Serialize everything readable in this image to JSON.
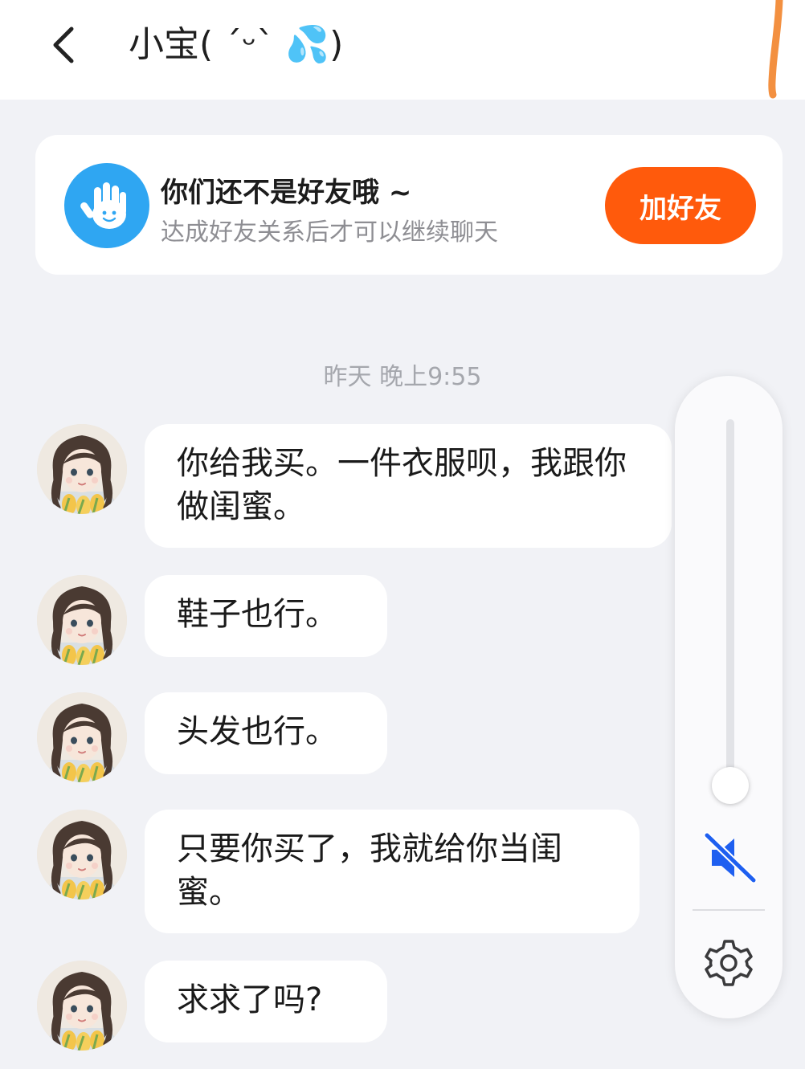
{
  "header": {
    "title": "小宝( ˊᵕˋ 💦)",
    "back_icon": "chevron-left-icon"
  },
  "friend_notice": {
    "title": "你们还不是好友哦 ~",
    "subtitle": "达成好友关系后才可以继续聊天",
    "button_label": "加好友",
    "icon": "hand-wave-icon",
    "accent_color": "#ff5a0c",
    "icon_color": "#2fa6f2"
  },
  "timestamp": "昨天 晚上9:55",
  "messages": [
    {
      "text": "你给我买。一件衣服呗，我跟你做闺蜜。"
    },
    {
      "text": "鞋子也行。"
    },
    {
      "text": "头发也行。"
    },
    {
      "text": "只要你买了，我就给你当闺蜜。"
    },
    {
      "text": "求求了吗?"
    }
  ],
  "volume_panel": {
    "level": 0,
    "muted": true,
    "mute_icon": "speaker-muted-icon",
    "settings_icon": "gear-icon",
    "mute_color": "#1e5ff0"
  }
}
